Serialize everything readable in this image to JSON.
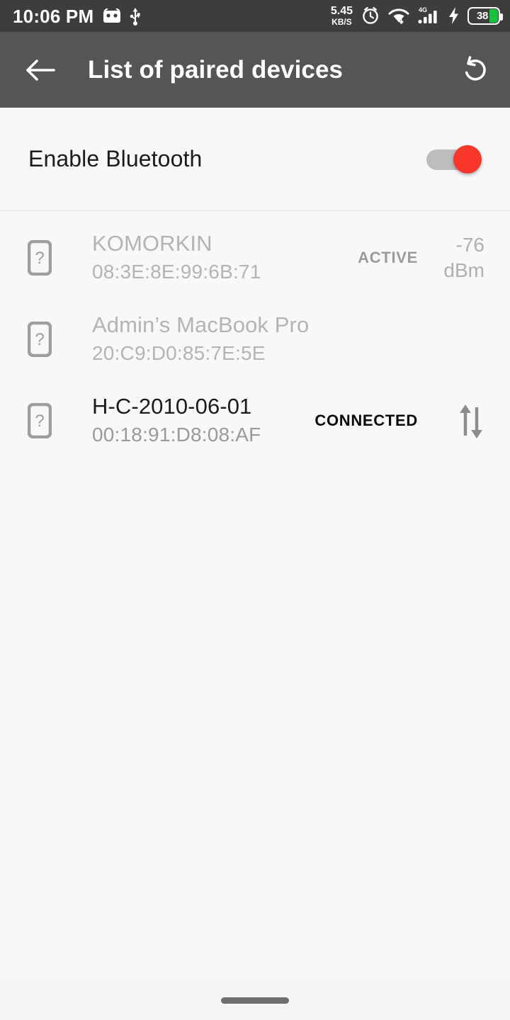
{
  "status_bar": {
    "clock": "10:06 PM",
    "left_icons": [
      "android-head-icon",
      "usb-icon"
    ],
    "network_speed_value": "5.45",
    "network_speed_unit": "KB/S",
    "right_icons": [
      "alarm-clock-icon",
      "wifi-icon",
      "mobile-signal-4g-icon",
      "charging-bolt-icon"
    ],
    "mobile_network_label": "4G",
    "battery_percent": "38",
    "battery_color": "#17c23c"
  },
  "app_bar": {
    "back_icon": "arrow-left-icon",
    "title": "List of paired devices",
    "refresh_icon": "rotate-left-refresh-icon",
    "background_color": "#555555"
  },
  "bluetooth_toggle": {
    "label": "Enable Bluetooth",
    "state": "on",
    "thumb_color": "#f8362a",
    "track_color": "#bdbdbd"
  },
  "devices": [
    {
      "icon": "unknown-device-icon",
      "name": "KOMORKIN",
      "mac": "08:3E:8E:99:6B:71",
      "status": "ACTIVE",
      "rssi": "-76 dBm",
      "rssi_value": "-76",
      "rssi_unit": "dBm",
      "enabled": false,
      "transfer_icon": null
    },
    {
      "icon": "unknown-device-icon",
      "name": "Admin’s MacBook Pro",
      "mac": "20:C9:D0:85:7E:5E",
      "status": "",
      "rssi": "",
      "enabled": false,
      "transfer_icon": null
    },
    {
      "icon": "unknown-device-icon",
      "name": "H-C-2010-06-01",
      "mac": "00:18:91:D8:08:AF",
      "status": "CONNECTED",
      "rssi": "",
      "enabled": true,
      "transfer_icon": "transfer-up-down-icon"
    }
  ],
  "nav_bar": {
    "gesture_pill": "home-gesture-pill"
  }
}
